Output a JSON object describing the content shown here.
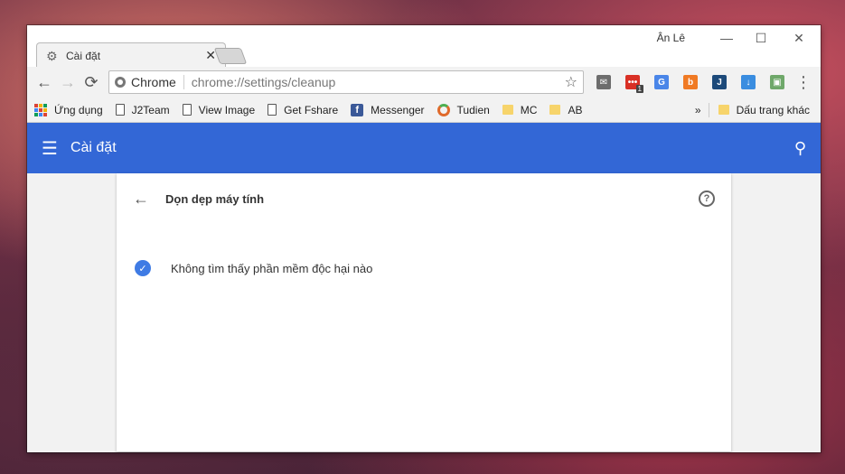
{
  "window": {
    "user_name": "Ân Lê",
    "controls": {
      "minimize": "—",
      "maximize": "☐",
      "close": "✕"
    }
  },
  "tab": {
    "title": "Cài đặt",
    "close": "✕"
  },
  "toolbar": {
    "back": "←",
    "forward": "→",
    "reload": "⟳",
    "origin_label": "Chrome",
    "url": "chrome://settings/cleanup",
    "star": "☆",
    "menu": "⋮",
    "extensions": [
      {
        "name": "mail-extension-icon",
        "glyph": "✉",
        "color": "#6d6d6d"
      },
      {
        "name": "message-extension-icon",
        "glyph": "•••",
        "color": "#d93025",
        "badge": "1"
      },
      {
        "name": "translate-extension-icon",
        "glyph": "G",
        "color": "#4a86e8"
      },
      {
        "name": "b-extension-icon",
        "glyph": "b",
        "color": "#f07a24"
      },
      {
        "name": "j-extension-icon",
        "glyph": "J",
        "color": "#1d4a7a"
      },
      {
        "name": "download-extension-icon",
        "glyph": "↓",
        "color": "#3a8de0"
      },
      {
        "name": "image-extension-icon",
        "glyph": "▣",
        "color": "#6fa86a"
      }
    ]
  },
  "bookmarks": {
    "items": [
      {
        "label": "Ứng dụng",
        "icon": "apps-grid-icon"
      },
      {
        "label": "J2Team",
        "icon": "page-icon"
      },
      {
        "label": "View Image",
        "icon": "page-icon"
      },
      {
        "label": "Get Fshare",
        "icon": "page-icon"
      },
      {
        "label": "Messenger",
        "icon": "facebook-icon"
      },
      {
        "label": "Tudien",
        "icon": "ring-icon"
      },
      {
        "label": "MC",
        "icon": "folder-icon"
      },
      {
        "label": "AB",
        "icon": "folder-icon"
      }
    ],
    "overflow": "»",
    "other_label": "Dấu trang khác"
  },
  "appbar": {
    "title": "Cài đặt",
    "menu": "☰",
    "search": "⚲"
  },
  "card": {
    "title": "Dọn dẹp máy tính",
    "back": "←",
    "help": "?",
    "status": "Không tìm thấy phần mềm độc hại nào",
    "check": "✓"
  }
}
